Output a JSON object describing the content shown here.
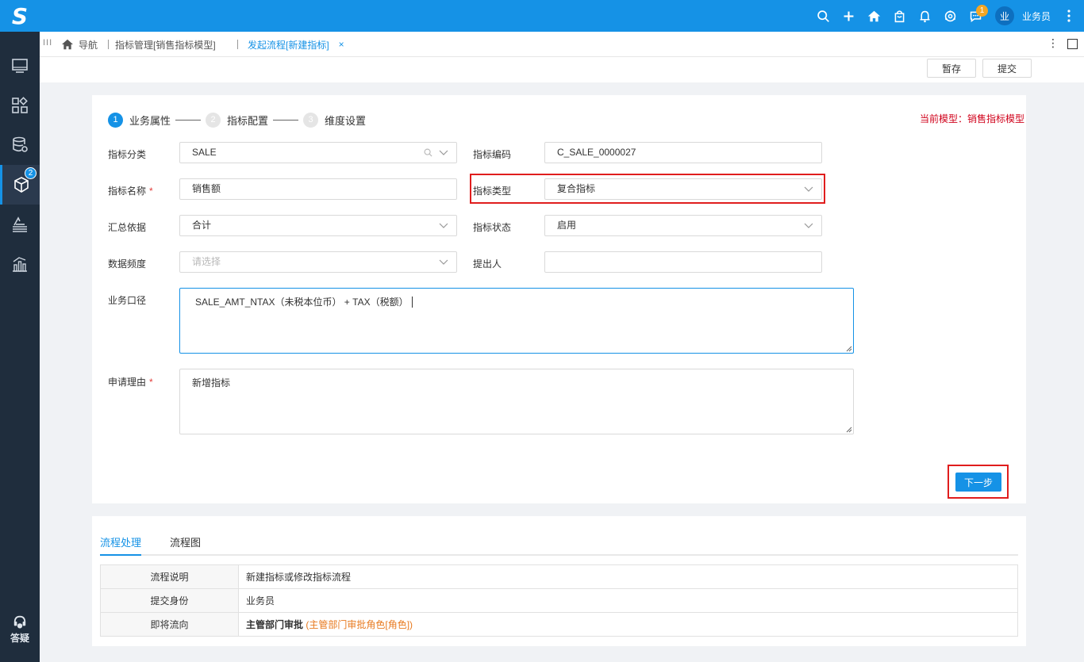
{
  "app": {
    "logo": "S"
  },
  "header": {
    "chat_badge": "1",
    "avatar_char": "业",
    "username": "业务员",
    "icons": [
      "search-icon",
      "plus-icon",
      "home-icon",
      "bag-icon",
      "bell-icon",
      "settings-icon",
      "chat-icon",
      "more-vertical-icon"
    ]
  },
  "sidebar": {
    "items": [
      {
        "icon": "monitor-icon"
      },
      {
        "icon": "apps-icon"
      },
      {
        "icon": "database-icon"
      },
      {
        "icon": "cube-icon",
        "badge": "2",
        "active": true
      },
      {
        "icon": "layers-icon"
      },
      {
        "icon": "chart-icon"
      }
    ],
    "help_label": "答疑"
  },
  "tabs": {
    "home_label": "导航",
    "tab1": "指标管理[销售指标模型]",
    "tab2": "发起流程[新建指标]",
    "close_symbol": "×"
  },
  "actions": {
    "save_draft": "暂存",
    "submit": "提交"
  },
  "steps": [
    {
      "num": "1",
      "label": "业务属性"
    },
    {
      "num": "2",
      "label": "指标配置"
    },
    {
      "num": "3",
      "label": "维度设置"
    }
  ],
  "current_model": "当前模型：销售指标模型",
  "form": {
    "category_label": "指标分类",
    "category_value": "SALE",
    "code_label": "指标编码",
    "code_value": "C_SALE_0000027",
    "name_label": "指标名称",
    "name_value": "销售额",
    "required_mark": "*",
    "type_label": "指标类型",
    "type_value": "复合指标",
    "aggregate_label": "汇总依据",
    "aggregate_value": "合计",
    "status_label": "指标状态",
    "status_value": "启用",
    "frequency_label": "数据频度",
    "frequency_placeholder": "请选择",
    "proposer_label": "提出人",
    "proposer_value": "",
    "caliber_label": "业务口径",
    "caliber_value": "SALE_AMT_NTAX（未税本位币） + TAX（税额）",
    "reason_label": "申请理由",
    "reason_value": "新增指标"
  },
  "next_button": "下一步",
  "flow": {
    "tab_process": "流程处理",
    "tab_chart": "流程图",
    "rows": [
      {
        "key": "流程说明",
        "value": "新建指标或修改指标流程"
      },
      {
        "key": "提交身份",
        "value": "业务员"
      },
      {
        "key": "即将流向",
        "value": "主管部门审批",
        "extra": "(主管部门审批角色[角色])"
      }
    ]
  },
  "colors": {
    "primary": "#1592e6",
    "sidebar": "#1f2d3d",
    "highlight": "#e01d1d",
    "model_text": "#d0021b"
  }
}
